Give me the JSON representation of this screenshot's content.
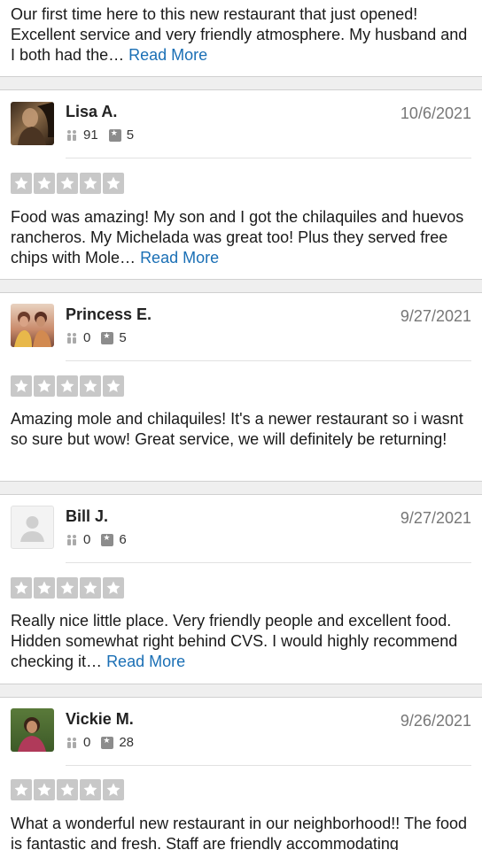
{
  "reviews": [
    {
      "text": "Our first time here to this new restaurant that just opened! Excellent service and very friendly atmosphere. My husband and I both had the…",
      "read_more": "Read More"
    },
    {
      "name": "Lisa A.",
      "date": "10/6/2021",
      "friends": "91",
      "review_count": "5",
      "rating": 5,
      "text": "Food was amazing! My son and I got the chilaquiles and huevos rancheros. My Michelada was great too! Plus they served free chips with Mole…",
      "read_more": "Read More"
    },
    {
      "name": "Princess E.",
      "date": "9/27/2021",
      "friends": "0",
      "review_count": "5",
      "rating": 5,
      "text": "Amazing mole and chilaquiles! It's a newer restaurant so i wasnt so sure but wow! Great service, we will definitely be returning!"
    },
    {
      "name": "Bill J.",
      "date": "9/27/2021",
      "friends": "0",
      "review_count": "6",
      "rating": 5,
      "text": "Really nice little place. Very friendly people and excellent food. Hidden somewhat right behind CVS. I would highly recommend checking it…",
      "read_more": "Read More"
    },
    {
      "name": "Vickie M.",
      "date": "9/26/2021",
      "friends": "0",
      "review_count": "28",
      "rating": 5,
      "text": "What a wonderful new restaurant in our neighborhood!! The food is fantastic and fresh. Staff are friendly accommodating"
    }
  ],
  "colors": {
    "link": "#1a6fb5",
    "star_box": "#c8c8c8",
    "separator": "#efefef"
  }
}
